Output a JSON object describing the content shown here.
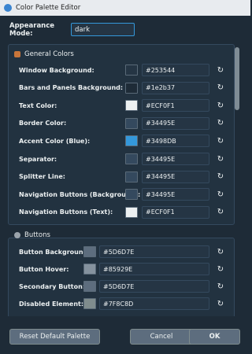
{
  "window": {
    "title": "Color Palette Editor"
  },
  "appearance": {
    "label": "Appearance Mode:",
    "value": "dark"
  },
  "general_colors": {
    "title": "General Colors",
    "rows": [
      {
        "label": "Window Background:",
        "hex": "#253544",
        "color": "#253544"
      },
      {
        "label": "Bars and Panels Background:",
        "hex": "#1e2b37",
        "color": "#1e2b37"
      },
      {
        "label": "Text Color:",
        "hex": "#ECF0F1",
        "color": "#ECF0F1"
      },
      {
        "label": "Border Color:",
        "hex": "#34495E",
        "color": "#34495E"
      },
      {
        "label": "Accent Color (Blue):",
        "hex": "#3498DB",
        "color": "#3498DB"
      },
      {
        "label": "Separator:",
        "hex": "#34495E",
        "color": "#34495E"
      },
      {
        "label": "Splitter Line:",
        "hex": "#34495E",
        "color": "#34495E"
      },
      {
        "label": "Navigation Buttons (Background):",
        "hex": "#34495E",
        "color": "#34495E"
      },
      {
        "label": "Navigation Buttons (Text):",
        "hex": "#ECF0F1",
        "color": "#ECF0F1"
      }
    ]
  },
  "buttons_group": {
    "title": "Buttons",
    "rows": [
      {
        "label": "Button Background:",
        "hex": "#5D6D7E",
        "color": "#5D6D7E"
      },
      {
        "label": "Button Hover:",
        "hex": "#85929E",
        "color": "#85929E"
      },
      {
        "label": "Secondary Button:",
        "hex": "#5D6D7E",
        "color": "#5D6D7E"
      },
      {
        "label": "Disabled Element:",
        "hex": "#7F8C8D",
        "color": "#7F8C8D"
      }
    ]
  },
  "footer": {
    "reset_label": "Reset Default Palette",
    "cancel_label": "Cancel",
    "ok_label": "OK"
  },
  "icons": {
    "reset_glyph": "↻"
  }
}
